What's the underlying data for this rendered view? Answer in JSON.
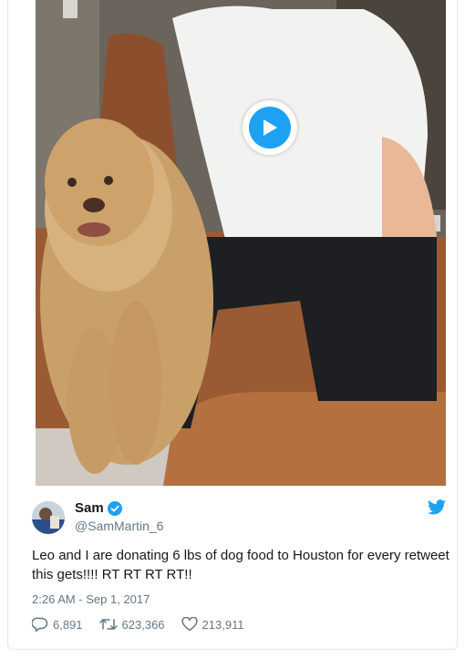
{
  "media": {
    "type": "video",
    "play_icon": "play-icon"
  },
  "tweet": {
    "author_name": "Sam",
    "verified_icon": "verified-badge-icon",
    "handle": "@SamMartin_6",
    "text": "Leo and I are donating 6 lbs of dog food to Houston for every retweet this gets!!!! RT RT RT RT!!",
    "timestamp": "2:26 AM - Sep 1, 2017",
    "replies": "6,891",
    "retweets": "623,366",
    "likes": "213,911",
    "brand_icon": "twitter-bird-icon"
  },
  "colors": {
    "accent": "#1da1f2",
    "text": "#14171a",
    "muted": "#657786"
  }
}
